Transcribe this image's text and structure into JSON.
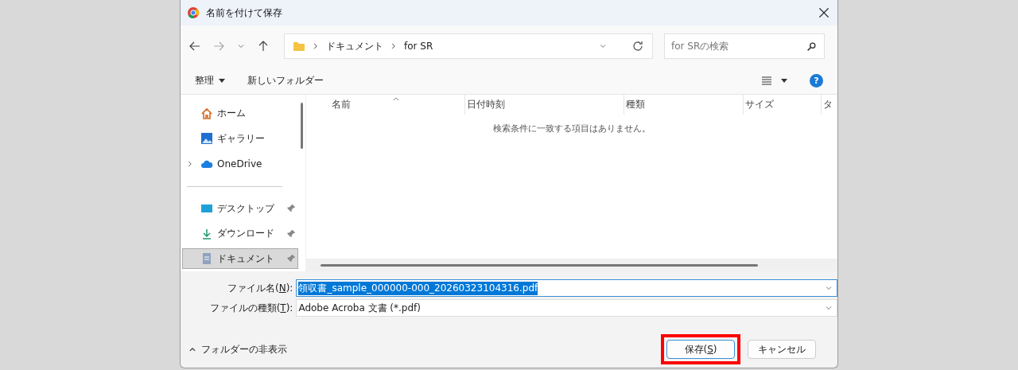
{
  "window": {
    "title": "名前を付けて保存"
  },
  "breadcrumb": [
    "ドキュメント",
    "for SR"
  ],
  "search": {
    "placeholder": "for SRの検索"
  },
  "toolbar": {
    "organize": "整理",
    "new_folder": "新しいフォルダー",
    "help": "?"
  },
  "sidebar": {
    "items": [
      {
        "label": "ホーム",
        "kind": "home",
        "pinned": false,
        "selected": false,
        "expandable": false
      },
      {
        "label": "ギャラリー",
        "kind": "gallery",
        "pinned": false,
        "selected": false,
        "expandable": false
      },
      {
        "label": "OneDrive",
        "kind": "cloud",
        "pinned": false,
        "selected": false,
        "expandable": true
      },
      {
        "label": "デスクトップ",
        "kind": "desktop",
        "pinned": true,
        "selected": false,
        "expandable": false
      },
      {
        "label": "ダウンロード",
        "kind": "download",
        "pinned": true,
        "selected": false,
        "expandable": false
      },
      {
        "label": "ドキュメント",
        "kind": "documents",
        "pinned": true,
        "selected": true,
        "expandable": false
      }
    ]
  },
  "table": {
    "columns": [
      "名前",
      "日付時刻",
      "種類",
      "サイズ",
      "タ"
    ],
    "empty_message": "検索条件に一致する項目はありません。"
  },
  "fields": [
    {
      "label_before": "ファイル名(",
      "access_key": "N",
      "label_after": "):",
      "value": "領収書_sample_000000-000_20260323104316.pdf",
      "selected": true
    },
    {
      "label_before": "ファイルの種類(",
      "access_key": "T",
      "label_after": "):",
      "value": "Adobe Acroba 文書 (*.pdf)",
      "selected": false
    }
  ],
  "hide_folders": "フォルダーの非表示",
  "buttons": [
    {
      "before": "保存(",
      "access_key": "S",
      "after": ")",
      "highlighted": true
    },
    {
      "before": "キャンセル",
      "highlighted": false
    }
  ]
}
